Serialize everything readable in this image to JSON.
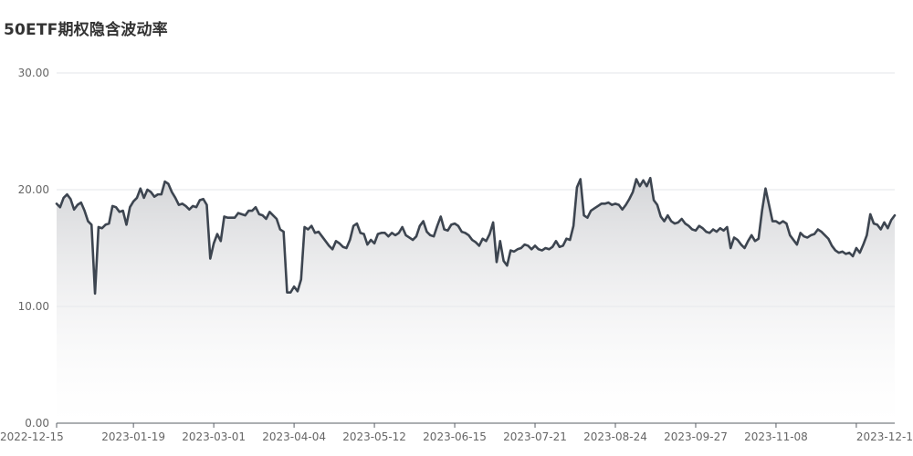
{
  "title": "50ETF期权隐含波动率",
  "colors": {
    "line": "#3d4550",
    "area_top": "#d2d3d6",
    "area_bottom": "#ffffff",
    "grid": "#e3e5ea",
    "axis": "#5a5f66",
    "tick_text": "#666666"
  },
  "chart_data": {
    "type": "area",
    "title": "50ETF期权隐含波动率",
    "xlabel": "",
    "ylabel": "",
    "ylim": [
      0,
      30
    ],
    "y_ticks": [
      "0.00",
      "10.00",
      "20.00",
      "30.00"
    ],
    "x_tick_labels": [
      "2022-12-15",
      "2023-01-19",
      "2023-03-01",
      "2023-04-04",
      "2023-05-12",
      "2023-06-15",
      "2023-07-21",
      "2023-08-24",
      "2023-09-27",
      "2023-11-08",
      "2023-12-1"
    ],
    "x_tick_indices": [
      0,
      22,
      45,
      68,
      91,
      114,
      137,
      160,
      183,
      206,
      229
    ],
    "grid": "horizontal",
    "legend": "none",
    "series": [
      {
        "values": [
          18.8,
          18.5,
          19.3,
          19.6,
          19.2,
          18.3,
          18.7,
          18.9,
          18.2,
          17.3,
          17.0,
          11.1,
          16.8,
          16.7,
          17.0,
          17.1,
          18.6,
          18.5,
          18.1,
          18.2,
          17.0,
          18.5,
          19.0,
          19.3,
          20.1,
          19.3,
          20.0,
          19.8,
          19.4,
          19.6,
          19.6,
          20.7,
          20.5,
          19.8,
          19.3,
          18.7,
          18.8,
          18.6,
          18.3,
          18.6,
          18.5,
          19.1,
          19.2,
          18.7,
          14.1,
          15.4,
          16.2,
          15.6,
          17.7,
          17.6,
          17.6,
          17.6,
          18.0,
          17.9,
          17.8,
          18.2,
          18.2,
          18.5,
          17.9,
          17.8,
          17.5,
          18.1,
          17.8,
          17.5,
          16.6,
          16.4,
          11.2,
          11.2,
          11.7,
          11.3,
          12.3,
          16.8,
          16.6,
          16.9,
          16.3,
          16.4,
          16.0,
          15.6,
          15.2,
          14.9,
          15.6,
          15.4,
          15.1,
          15.0,
          15.7,
          16.9,
          17.1,
          16.3,
          16.2,
          15.3,
          15.7,
          15.4,
          16.2,
          16.3,
          16.3,
          16.0,
          16.3,
          16.1,
          16.3,
          16.8,
          16.1,
          15.9,
          15.7,
          16.0,
          16.9,
          17.3,
          16.4,
          16.1,
          16.0,
          16.9,
          17.7,
          16.6,
          16.5,
          17.0,
          17.1,
          16.9,
          16.4,
          16.3,
          16.1,
          15.7,
          15.5,
          15.2,
          15.8,
          15.6,
          16.2,
          17.2,
          13.8,
          15.6,
          13.9,
          13.5,
          14.8,
          14.7,
          14.9,
          15.0,
          15.3,
          15.2,
          14.9,
          15.2,
          14.9,
          14.8,
          15.0,
          14.9,
          15.1,
          15.6,
          15.1,
          15.2,
          15.8,
          15.7,
          16.9,
          20.2,
          20.9,
          17.8,
          17.6,
          18.2,
          18.4,
          18.6,
          18.8,
          18.8,
          18.9,
          18.7,
          18.8,
          18.7,
          18.3,
          18.7,
          19.2,
          19.8,
          20.9,
          20.3,
          20.8,
          20.3,
          21.0,
          19.1,
          18.7,
          17.7,
          17.3,
          17.8,
          17.3,
          17.1,
          17.2,
          17.5,
          17.1,
          16.9,
          16.6,
          16.5,
          16.9,
          16.7,
          16.4,
          16.3,
          16.6,
          16.4,
          16.7,
          16.5,
          16.8,
          15.0,
          15.9,
          15.7,
          15.3,
          15.0,
          15.6,
          16.1,
          15.6,
          15.8,
          18.2,
          20.1,
          18.7,
          17.3,
          17.3,
          17.1,
          17.3,
          17.1,
          16.1,
          15.7,
          15.3,
          16.3,
          16.0,
          15.9,
          16.1,
          16.2,
          16.6,
          16.4,
          16.1,
          15.8,
          15.2,
          14.8,
          14.6,
          14.7,
          14.5,
          14.6,
          14.3,
          15.0,
          14.6,
          15.3,
          16.1,
          17.9,
          17.1,
          17.0,
          16.6,
          17.2,
          16.7,
          17.4,
          17.8
        ]
      }
    ]
  }
}
